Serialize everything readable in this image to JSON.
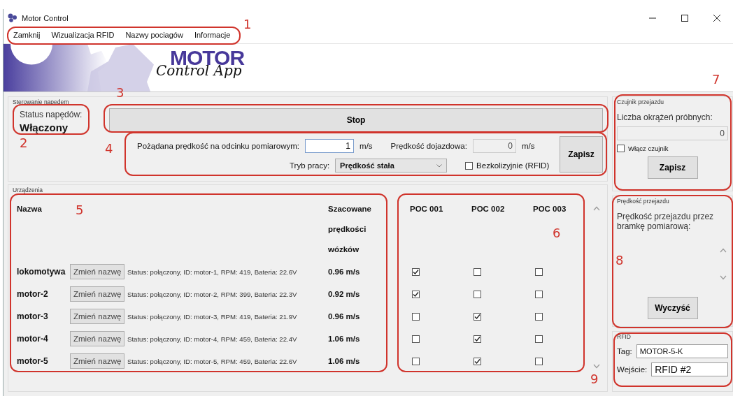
{
  "window": {
    "title": "Motor Control"
  },
  "menu": [
    {
      "label": "Zamknij"
    },
    {
      "label": "Wizualizacja RFID"
    },
    {
      "label": "Nazwy pociagów"
    },
    {
      "label": "Informacje"
    }
  ],
  "banner": {
    "logo_main": "MOTOR",
    "logo_sub": "Control App"
  },
  "drive": {
    "group_title": "Sterowanie napędem",
    "status_label": "Status napędów:",
    "status_value": "Włączony",
    "stop_button": "Stop",
    "speed_label": "Pożądana prędkość na odcinku pomiarowym:",
    "speed_field": {
      "value": "1",
      "disabled": false
    },
    "speed_unit": "m/s",
    "approach_label": "Prędkość dojazdowa:",
    "approach_field": {
      "value": "0",
      "disabled": true
    },
    "approach_unit": "m/s",
    "mode_label": "Tryb pracy:",
    "mode_value": "Prędkość stała",
    "collision_label": "Bezkolizyjnie (RFID)",
    "collision_checked": false,
    "save_button": "Zapisz"
  },
  "devices": {
    "group_title": "Urządzenia",
    "col_name": "Nazwa",
    "col_speed": [
      "Szacowane",
      "prędkości",
      "wózków"
    ],
    "poc_columns": [
      "POC 001",
      "POC 002",
      "POC 003"
    ],
    "rows": [
      {
        "name": "lokomotywa",
        "rename_button": "Zmień nazwę",
        "status": "Status: połączony, ID: motor-1, RPM: 419, Bateria: 22.6V",
        "speed": "0.96 m/s",
        "checks": [
          {
            "checked": true
          },
          {
            "checked": false
          },
          {
            "checked": false
          }
        ]
      },
      {
        "name": "motor-2",
        "rename_button": "Zmień nazwę",
        "status": "Status: połączony, ID: motor-2, RPM: 399, Bateria: 22.3V",
        "speed": "0.92 m/s",
        "checks": [
          {
            "checked": true
          },
          {
            "checked": false
          },
          {
            "checked": false
          }
        ]
      },
      {
        "name": "motor-3",
        "rename_button": "Zmień nazwę",
        "status": "Status: połączony, ID: motor-3, RPM: 419, Bateria: 21.9V",
        "speed": "0.96 m/s",
        "checks": [
          {
            "checked": false
          },
          {
            "checked": true
          },
          {
            "checked": false
          }
        ]
      },
      {
        "name": "motor-4",
        "rename_button": "Zmień nazwę",
        "status": "Status: połączony, ID: motor-4, RPM: 459, Bateria: 22.4V",
        "speed": "1.06 m/s",
        "checks": [
          {
            "checked": false
          },
          {
            "checked": true
          },
          {
            "checked": false
          }
        ]
      },
      {
        "name": "motor-5",
        "rename_button": "Zmień nazwę",
        "status": "Status: połączony, ID: motor-5, RPM: 459, Bateria: 22.6V",
        "speed": "1.06 m/s",
        "checks": [
          {
            "checked": false
          },
          {
            "checked": true
          },
          {
            "checked": false
          }
        ]
      }
    ]
  },
  "sensor": {
    "group_title": "Czujnik przejazdu",
    "laps_label": "Liczba okrążeń próbnych:",
    "laps_field": {
      "value": "0",
      "disabled": true
    },
    "enable_label": "Włącz czujnik",
    "enable_checked": false,
    "save_button": "Zapisz"
  },
  "pass_speed": {
    "group_title": "Prędkość przejazdu",
    "label": "Prędkość przejazdu przez bramkę pomiarową:",
    "clear_button": "Wyczyść"
  },
  "rfid": {
    "group_title": "RFID",
    "tag_label": "Tag:",
    "tag_value": "MOTOR-5-K",
    "input_label": "Wejście:",
    "input_value": "RFID #2"
  },
  "annotations": [
    {
      "number": "1"
    },
    {
      "number": "2"
    },
    {
      "number": "3"
    },
    {
      "number": "4"
    },
    {
      "number": "5"
    },
    {
      "number": "6"
    },
    {
      "number": "7"
    },
    {
      "number": "8"
    },
    {
      "number": "9"
    }
  ]
}
